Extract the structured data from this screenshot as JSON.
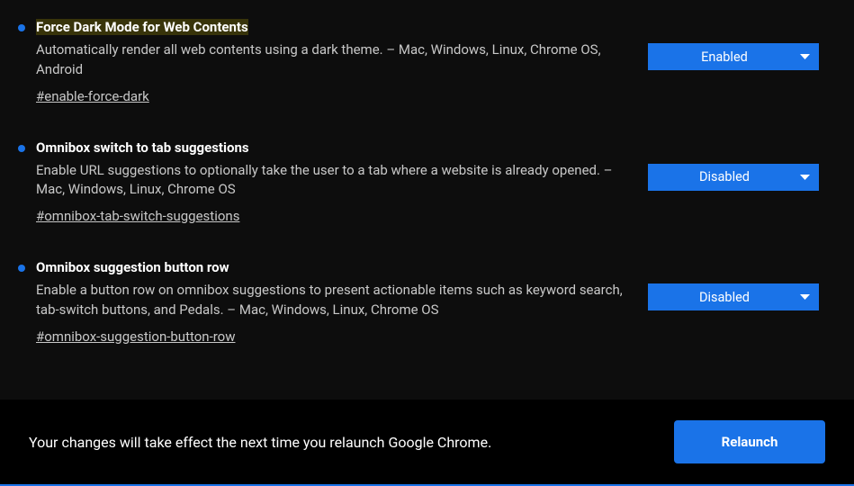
{
  "flags": [
    {
      "title": "Force Dark Mode for Web Contents",
      "highlighted": true,
      "description": "Automatically render all web contents using a dark theme. – Mac, Windows, Linux, Chrome OS, Android",
      "hash": "#enable-force-dark",
      "selected": "Enabled"
    },
    {
      "title": "Omnibox switch to tab suggestions",
      "highlighted": false,
      "description": "Enable URL suggestions to optionally take the user to a tab where a website is already opened. – Mac, Windows, Linux, Chrome OS",
      "hash": "#omnibox-tab-switch-suggestions",
      "selected": "Disabled"
    },
    {
      "title": "Omnibox suggestion button row",
      "highlighted": false,
      "description": "Enable a button row on omnibox suggestions to present actionable items such as keyword search, tab-switch buttons, and Pedals. – Mac, Windows, Linux, Chrome OS",
      "hash": "#omnibox-suggestion-button-row",
      "selected": "Disabled"
    }
  ],
  "relaunch": {
    "message": "Your changes will take effect the next time you relaunch Google Chrome.",
    "button": "Relaunch"
  }
}
